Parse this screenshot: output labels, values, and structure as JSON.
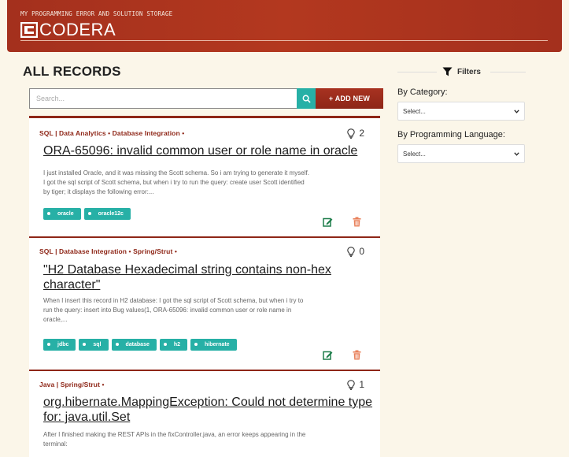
{
  "header": {
    "tagline": "MY PROGRAMMING ERROR AND SOLUTION STORAGE",
    "brand": "CODERA"
  },
  "main": {
    "title": "ALL RECORDS",
    "search_placeholder": "Search...",
    "add_label": "+ ADD NEW"
  },
  "records": [
    {
      "meta": "SQL |  Data Analytics • Database Integration •",
      "likes": "2",
      "title": "ORA-65096: invalid common user or role name in oracle",
      "excerpt": "I just installed Oracle, and it was missing the Scott schema. So i am trying to generate it myself. I got the sql script of Scott schema, but when i try to run the query: create user Scott identified by tiger; it displays the following error:...",
      "tags": [
        "oracle",
        "oracle12c"
      ]
    },
    {
      "meta": "SQL |  Database Integration • Spring/Strut •",
      "likes": "0",
      "title": "\"H2 Database Hexadecimal string contains non-hex character\"",
      "excerpt": "When I insert this record in H2 database: I got the sql script of Scott schema, but when i try to run the query: insert into Bug values(1, ORA-65096: invalid common user or role name in oracle,...",
      "tags": [
        "jdbc",
        "sql",
        "database",
        "h2",
        "hibernate"
      ]
    },
    {
      "meta": "Java |  Spring/Strut •",
      "likes": "1",
      "title": "org.hibernate.MappingException: Could not determine type for: java.util.Set",
      "excerpt": "After I finished making the REST APIs in the fixController.java, an error keeps appearing in the terminal:",
      "tags": []
    }
  ],
  "sidebar": {
    "filters_label": "Filters",
    "category_label": "By Category:",
    "category_value": "Select...",
    "language_label": "By Programming Language:",
    "language_value": "Select..."
  },
  "colors": {
    "brand": "#a4301d",
    "accent": "#27b0a6",
    "delete": "#e8805a"
  },
  "icons": [
    "codera-logo-icon",
    "search-icon",
    "lightbulb-icon",
    "edit-icon",
    "trash-icon",
    "filter-icon",
    "chevron-down-icon"
  ]
}
